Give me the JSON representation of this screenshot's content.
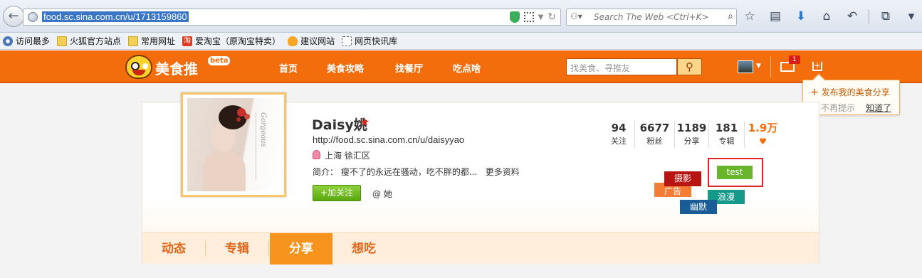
{
  "browser": {
    "url": "food.sc.sina.com.cn/u/1713159860",
    "search_placeholder": "Search The Web <Ctrl+K>"
  },
  "bookmarks": [
    {
      "label": "访问最多",
      "icon": "gear-icon"
    },
    {
      "label": "火狐官方站点",
      "icon": "folder-icon"
    },
    {
      "label": "常用网址",
      "icon": "folder-icon"
    },
    {
      "label": "爱淘宝（原淘宝特卖）",
      "icon": "taobao-icon"
    },
    {
      "label": "建议网站",
      "icon": "bulb-icon"
    },
    {
      "label": "网页快讯库",
      "icon": "webslice-icon"
    }
  ],
  "site": {
    "logo": "美食推",
    "beta": "beta",
    "nav": [
      "首页",
      "美食攻略",
      "找餐厅",
      "吃点啥"
    ],
    "search_placeholder": "找美食、寻推友",
    "mail_badge": "1",
    "brand_color": "#f36d0c"
  },
  "popup": {
    "title": "发布我的美食分享",
    "no_more": "不再提示",
    "ok": "知道了"
  },
  "profile": {
    "name": "Daisy姚",
    "url": "http://food.sc.sina.com.cn/u/daisyyao",
    "location": "上海 徐汇区",
    "bio": "简介： 瘦不了的永远在骚动，吃不胖的都...",
    "more": "更多资料",
    "follow": "加关注",
    "at": "@ 她",
    "avatar_text": "Gorgeous"
  },
  "stats": [
    {
      "num": "94",
      "label": "关注"
    },
    {
      "num": "6677",
      "label": "粉丝"
    },
    {
      "num": "1189",
      "label": "分享"
    },
    {
      "num": "181",
      "label": "专辑"
    },
    {
      "num": "1.9万",
      "label": "♥"
    }
  ],
  "tags": {
    "photo": "摄影",
    "ad": "广告",
    "test": "test",
    "romance": "浪漫",
    "humor": "幽默"
  },
  "tabs": [
    "动态",
    "专辑",
    "分享",
    "想吃"
  ],
  "active_tab": "分享"
}
